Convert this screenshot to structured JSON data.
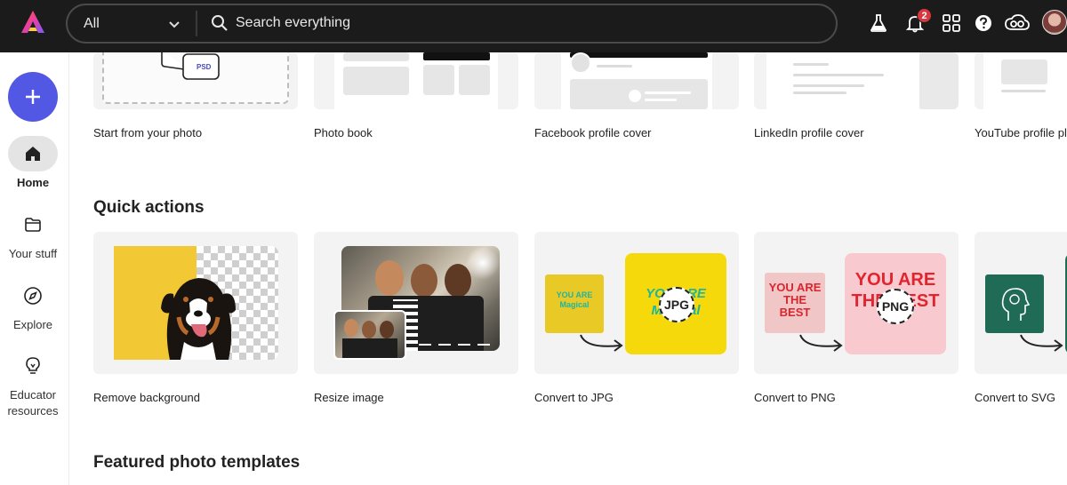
{
  "header": {
    "search_scope": "All",
    "search_placeholder": "Search everything",
    "notification_count": "2"
  },
  "sidebar": {
    "items": [
      {
        "label": "Home"
      },
      {
        "label": "Your stuff"
      },
      {
        "label": "Explore"
      },
      {
        "label": "Educator resources"
      }
    ]
  },
  "templates_row": {
    "cards": [
      {
        "label": "Start from your photo",
        "badge": "PSD"
      },
      {
        "label": "Photo book"
      },
      {
        "label": "Facebook profile cover"
      },
      {
        "label": "LinkedIn profile cover"
      },
      {
        "label": "YouTube profile pl"
      }
    ]
  },
  "quick_actions": {
    "title": "Quick actions",
    "cards": [
      {
        "label": "Remove background"
      },
      {
        "label": "Resize image"
      },
      {
        "label": "Convert to JPG",
        "thumb_text": "YOU ARE Magical",
        "format": "JPG"
      },
      {
        "label": "Convert to PNG",
        "thumb_text": "YOU ARE THE BEST",
        "format": "PNG"
      },
      {
        "label": "Convert to SVG"
      }
    ]
  },
  "featured": {
    "title": "Featured photo templates"
  },
  "colors": {
    "topbar_bg": "#1b1b1b",
    "create_button": "#5258e4",
    "badge": "#d7373f"
  }
}
